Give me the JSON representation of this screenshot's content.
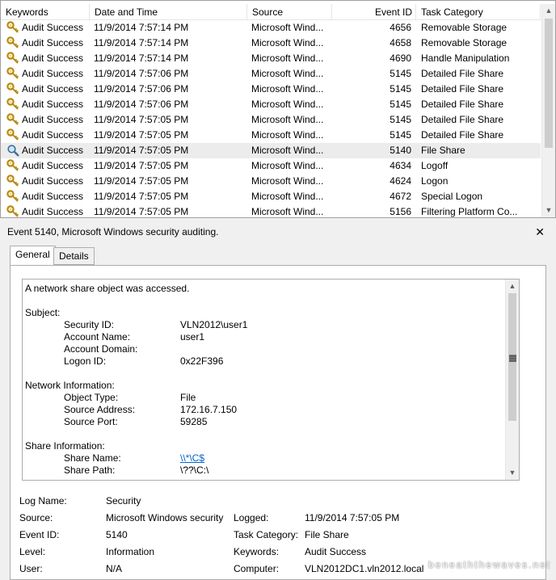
{
  "columns": {
    "keywords": "Keywords",
    "datetime": "Date and Time",
    "source": "Source",
    "event_id": "Event ID",
    "task_category": "Task Category"
  },
  "events": [
    {
      "keywords": "Audit Success",
      "datetime": "11/9/2014 7:57:14 PM",
      "source": "Microsoft Wind...",
      "event_id": "4656",
      "task_category": "Removable Storage",
      "icon": "key-icon"
    },
    {
      "keywords": "Audit Success",
      "datetime": "11/9/2014 7:57:14 PM",
      "source": "Microsoft Wind...",
      "event_id": "4658",
      "task_category": "Removable Storage",
      "icon": "key-icon"
    },
    {
      "keywords": "Audit Success",
      "datetime": "11/9/2014 7:57:14 PM",
      "source": "Microsoft Wind...",
      "event_id": "4690",
      "task_category": "Handle Manipulation",
      "icon": "key-icon"
    },
    {
      "keywords": "Audit Success",
      "datetime": "11/9/2014 7:57:06 PM",
      "source": "Microsoft Wind...",
      "event_id": "5145",
      "task_category": "Detailed File Share",
      "icon": "key-icon"
    },
    {
      "keywords": "Audit Success",
      "datetime": "11/9/2014 7:57:06 PM",
      "source": "Microsoft Wind...",
      "event_id": "5145",
      "task_category": "Detailed File Share",
      "icon": "key-icon"
    },
    {
      "keywords": "Audit Success",
      "datetime": "11/9/2014 7:57:06 PM",
      "source": "Microsoft Wind...",
      "event_id": "5145",
      "task_category": "Detailed File Share",
      "icon": "key-icon"
    },
    {
      "keywords": "Audit Success",
      "datetime": "11/9/2014 7:57:05 PM",
      "source": "Microsoft Wind...",
      "event_id": "5145",
      "task_category": "Detailed File Share",
      "icon": "key-icon"
    },
    {
      "keywords": "Audit Success",
      "datetime": "11/9/2014 7:57:05 PM",
      "source": "Microsoft Wind...",
      "event_id": "5145",
      "task_category": "Detailed File Share",
      "icon": "key-icon"
    },
    {
      "keywords": "Audit Success",
      "datetime": "11/9/2014 7:57:05 PM",
      "source": "Microsoft Wind...",
      "event_id": "5140",
      "task_category": "File Share",
      "icon": "magnifier-icon",
      "selected": true
    },
    {
      "keywords": "Audit Success",
      "datetime": "11/9/2014 7:57:05 PM",
      "source": "Microsoft Wind...",
      "event_id": "4634",
      "task_category": "Logoff",
      "icon": "key-icon"
    },
    {
      "keywords": "Audit Success",
      "datetime": "11/9/2014 7:57:05 PM",
      "source": "Microsoft Wind...",
      "event_id": "4624",
      "task_category": "Logon",
      "icon": "key-icon"
    },
    {
      "keywords": "Audit Success",
      "datetime": "11/9/2014 7:57:05 PM",
      "source": "Microsoft Wind...",
      "event_id": "4672",
      "task_category": "Special Logon",
      "icon": "key-icon"
    },
    {
      "keywords": "Audit Success",
      "datetime": "11/9/2014 7:57:05 PM",
      "source": "Microsoft Wind...",
      "event_id": "5156",
      "task_category": "Filtering Platform Co...",
      "icon": "key-icon"
    }
  ],
  "detail": {
    "title": "Event 5140, Microsoft Windows security auditing.",
    "close": "✕",
    "tabs": [
      "General",
      "Details"
    ],
    "description": {
      "intro": "A network share object was accessed.",
      "sections": [
        {
          "heading": "Subject:",
          "fields": [
            {
              "key": "Security ID:",
              "value": "VLN2012\\user1"
            },
            {
              "key": "Account Name:",
              "value": "user1"
            },
            {
              "key": "Account Domain:",
              "value": ""
            },
            {
              "key": "Logon ID:",
              "value": "0x22F396"
            }
          ]
        },
        {
          "heading": "Network Information:",
          "fields": [
            {
              "key": "Object Type:",
              "value": "File"
            },
            {
              "key": "Source Address:",
              "value": "172.16.7.150"
            },
            {
              "key": "Source Port:",
              "value": "59285"
            }
          ]
        },
        {
          "heading": "Share Information:",
          "fields": [
            {
              "key": "Share Name:",
              "value": "\\\\*\\C$",
              "link": true
            },
            {
              "key": "Share Path:",
              "value": "\\??\\C:\\"
            }
          ]
        }
      ]
    },
    "properties": {
      "log_name_label": "Log Name:",
      "log_name": "Security",
      "source_label": "Source:",
      "source": "Microsoft Windows security",
      "logged_label": "Logged:",
      "logged": "11/9/2014 7:57:05 PM",
      "event_id_label": "Event ID:",
      "event_id": "5140",
      "task_category_label": "Task Category:",
      "task_category": "File Share",
      "level_label": "Level:",
      "level": "Information",
      "keywords_label": "Keywords:",
      "keywords": "Audit Success",
      "user_label": "User:",
      "user": "N/A",
      "computer_label": "Computer:",
      "computer": "VLN2012DC1.vln2012.local"
    }
  },
  "watermark": "beneaththewaves.net",
  "colors": {
    "link": "#0066cc",
    "selected_row": "#ececec",
    "key_icon": "#c8a020"
  }
}
